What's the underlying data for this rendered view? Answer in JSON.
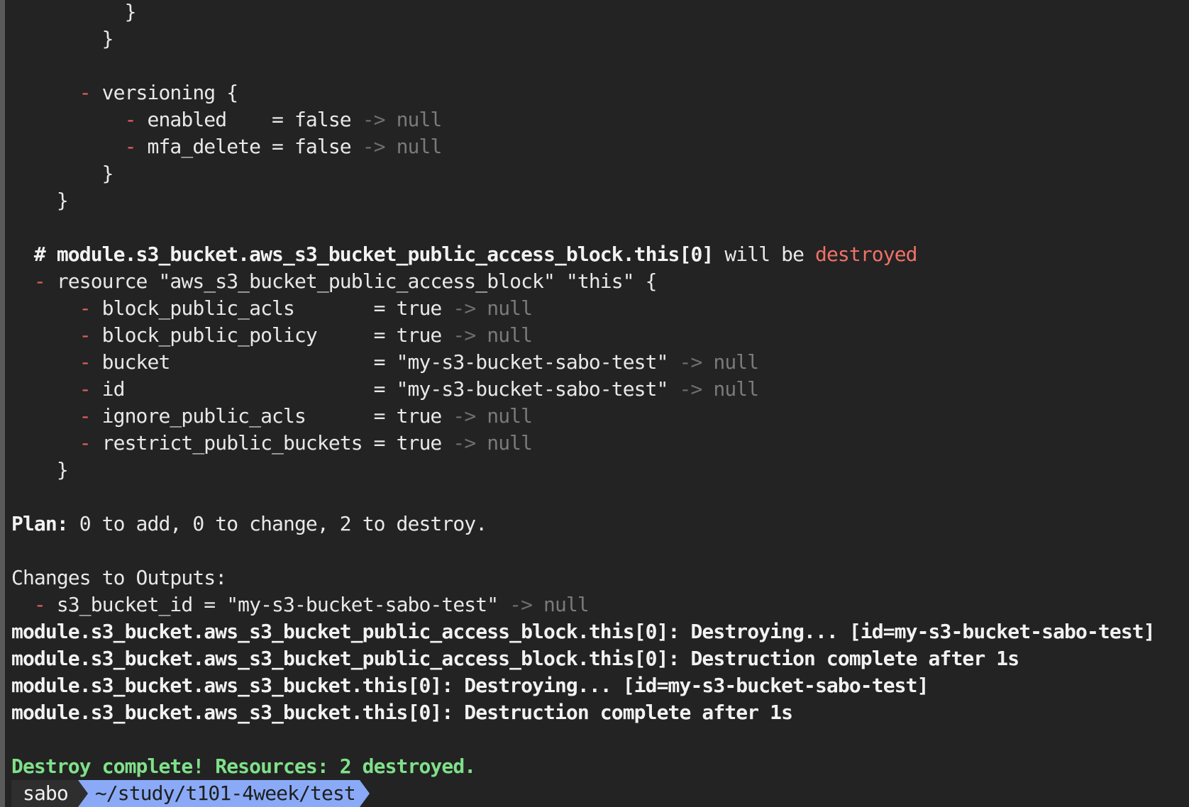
{
  "terminal": {
    "lines": [
      {
        "indent": "          ",
        "parts": [
          {
            "t": "}",
            "c": ""
          }
        ]
      },
      {
        "indent": "        ",
        "parts": [
          {
            "t": "}",
            "c": ""
          }
        ]
      },
      {
        "indent": "",
        "parts": []
      },
      {
        "indent": "      ",
        "parts": [
          {
            "t": "- ",
            "c": "minus"
          },
          {
            "t": "versioning {",
            "c": ""
          }
        ]
      },
      {
        "indent": "          ",
        "parts": [
          {
            "t": "- ",
            "c": "minus"
          },
          {
            "t": "enabled    = false ",
            "c": ""
          },
          {
            "t": "-> ",
            "c": "arrow"
          },
          {
            "t": "null",
            "c": "null"
          }
        ]
      },
      {
        "indent": "          ",
        "parts": [
          {
            "t": "- ",
            "c": "minus"
          },
          {
            "t": "mfa_delete = false ",
            "c": ""
          },
          {
            "t": "-> ",
            "c": "arrow"
          },
          {
            "t": "null",
            "c": "null"
          }
        ]
      },
      {
        "indent": "        ",
        "parts": [
          {
            "t": "}",
            "c": ""
          }
        ]
      },
      {
        "indent": "    ",
        "parts": [
          {
            "t": "}",
            "c": ""
          }
        ]
      },
      {
        "indent": "",
        "parts": []
      },
      {
        "indent": "  ",
        "parts": [
          {
            "t": "# module.s3_bucket.aws_s3_bucket_public_access_block.this[0]",
            "c": "bold"
          },
          {
            "t": " will be ",
            "c": ""
          },
          {
            "t": "destroyed",
            "c": "red"
          }
        ]
      },
      {
        "indent": "  ",
        "parts": [
          {
            "t": "- ",
            "c": "minus"
          },
          {
            "t": "resource \"aws_s3_bucket_public_access_block\" \"this\" {",
            "c": ""
          }
        ]
      },
      {
        "indent": "      ",
        "parts": [
          {
            "t": "- ",
            "c": "minus"
          },
          {
            "t": "block_public_acls       = true ",
            "c": ""
          },
          {
            "t": "-> ",
            "c": "arrow"
          },
          {
            "t": "null",
            "c": "null"
          }
        ]
      },
      {
        "indent": "      ",
        "parts": [
          {
            "t": "- ",
            "c": "minus"
          },
          {
            "t": "block_public_policy     = true ",
            "c": ""
          },
          {
            "t": "-> ",
            "c": "arrow"
          },
          {
            "t": "null",
            "c": "null"
          }
        ]
      },
      {
        "indent": "      ",
        "parts": [
          {
            "t": "- ",
            "c": "minus"
          },
          {
            "t": "bucket                  = \"my-s3-bucket-sabo-test\" ",
            "c": ""
          },
          {
            "t": "-> ",
            "c": "arrow"
          },
          {
            "t": "null",
            "c": "null"
          }
        ]
      },
      {
        "indent": "      ",
        "parts": [
          {
            "t": "- ",
            "c": "minus"
          },
          {
            "t": "id                      = \"my-s3-bucket-sabo-test\" ",
            "c": ""
          },
          {
            "t": "-> ",
            "c": "arrow"
          },
          {
            "t": "null",
            "c": "null"
          }
        ]
      },
      {
        "indent": "      ",
        "parts": [
          {
            "t": "- ",
            "c": "minus"
          },
          {
            "t": "ignore_public_acls      = true ",
            "c": ""
          },
          {
            "t": "-> ",
            "c": "arrow"
          },
          {
            "t": "null",
            "c": "null"
          }
        ]
      },
      {
        "indent": "      ",
        "parts": [
          {
            "t": "- ",
            "c": "minus"
          },
          {
            "t": "restrict_public_buckets = true ",
            "c": ""
          },
          {
            "t": "-> ",
            "c": "arrow"
          },
          {
            "t": "null",
            "c": "null"
          }
        ]
      },
      {
        "indent": "    ",
        "parts": [
          {
            "t": "}",
            "c": ""
          }
        ]
      },
      {
        "indent": "",
        "parts": []
      },
      {
        "indent": "",
        "parts": [
          {
            "t": "Plan:",
            "c": "bold"
          },
          {
            "t": " 0 to add, 0 to change, 2 to destroy.",
            "c": ""
          }
        ]
      },
      {
        "indent": "",
        "parts": []
      },
      {
        "indent": "",
        "parts": [
          {
            "t": "Changes to Outputs:",
            "c": ""
          }
        ]
      },
      {
        "indent": "  ",
        "parts": [
          {
            "t": "- ",
            "c": "minus"
          },
          {
            "t": "s3_bucket_id = \"my-s3-bucket-sabo-test\" ",
            "c": ""
          },
          {
            "t": "-> ",
            "c": "arrow"
          },
          {
            "t": "null",
            "c": "null"
          }
        ]
      },
      {
        "indent": "",
        "parts": [
          {
            "t": "module.s3_bucket.aws_s3_bucket_public_access_block.this[0]: Destroying... [id=my-s3-bucket-sabo-test]",
            "c": "bold"
          }
        ]
      },
      {
        "indent": "",
        "parts": [
          {
            "t": "module.s3_bucket.aws_s3_bucket_public_access_block.this[0]: Destruction complete after 1s",
            "c": "bold"
          }
        ]
      },
      {
        "indent": "",
        "parts": [
          {
            "t": "module.s3_bucket.aws_s3_bucket.this[0]: Destroying... [id=my-s3-bucket-sabo-test]",
            "c": "bold"
          }
        ]
      },
      {
        "indent": "",
        "parts": [
          {
            "t": "module.s3_bucket.aws_s3_bucket.this[0]: Destruction complete after 1s",
            "c": "bold"
          }
        ]
      },
      {
        "indent": "",
        "parts": []
      },
      {
        "indent": "",
        "parts": [
          {
            "t": "Destroy complete! Resources: 2 destroyed.",
            "c": "green"
          }
        ]
      }
    ]
  },
  "prompt": {
    "user": "sabo",
    "path": "~/study/t101-4week/test"
  },
  "colors": {
    "background": "#232323",
    "minus": "#e5605c",
    "destroyed": "#f07168",
    "success": "#7fe08a",
    "prompt_path_bg": "#8aaaf7"
  }
}
